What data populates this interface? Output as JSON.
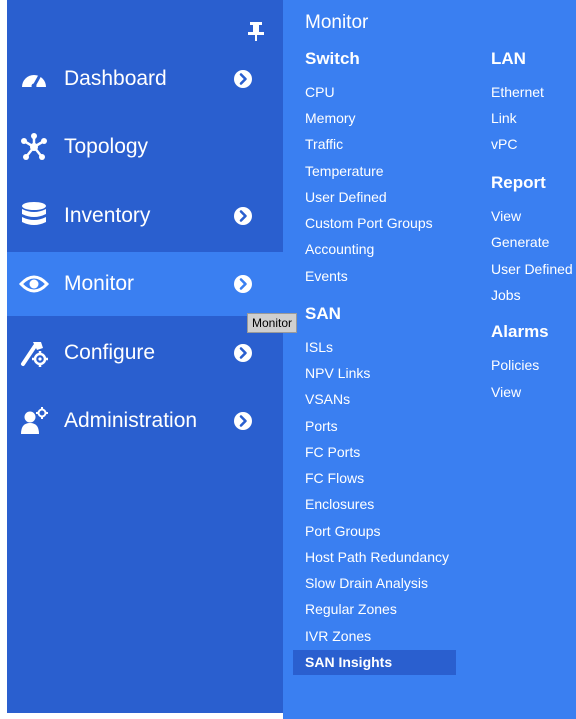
{
  "sidebar": {
    "items": [
      {
        "label": "Dashboard",
        "icon": "dashboard-gauge-icon",
        "has_chevron": true
      },
      {
        "label": "Topology",
        "icon": "topology-icon",
        "has_chevron": false
      },
      {
        "label": "Inventory",
        "icon": "database-icon",
        "has_chevron": true
      },
      {
        "label": "Monitor",
        "icon": "eye-icon",
        "has_chevron": true,
        "active": true
      },
      {
        "label": "Configure",
        "icon": "configure-tools-icon",
        "has_chevron": true
      },
      {
        "label": "Administration",
        "icon": "admin-user-gear-icon",
        "has_chevron": true
      }
    ]
  },
  "tooltip": {
    "text": "Monitor"
  },
  "flyout": {
    "title": "Monitor",
    "switch": {
      "title": "Switch",
      "links": [
        "CPU",
        "Memory",
        "Traffic",
        "Temperature",
        "User Defined",
        "Custom Port Groups",
        "Accounting",
        "Events"
      ]
    },
    "san": {
      "title": "SAN",
      "links": [
        "ISLs",
        "NPV Links",
        "VSANs",
        "Ports",
        "FC Ports",
        "FC Flows",
        "Enclosures",
        "Port Groups",
        "Host Path Redundancy",
        "Slow Drain Analysis",
        "Regular Zones",
        "IVR Zones",
        "SAN Insights"
      ],
      "selected": "SAN Insights"
    },
    "lan": {
      "title": "LAN",
      "links": [
        "Ethernet",
        "Link",
        "vPC"
      ]
    },
    "report": {
      "title": "Report",
      "links": [
        "View",
        "Generate",
        "User Defined",
        "Jobs"
      ]
    },
    "alarms": {
      "title": "Alarms",
      "links": [
        "Policies",
        "View"
      ]
    }
  },
  "colors": {
    "sidebar_bg": "#2a5fcf",
    "active_bg": "#3a7ff1",
    "flyout_bg": "#3a7ff1",
    "text": "#ffffff"
  }
}
